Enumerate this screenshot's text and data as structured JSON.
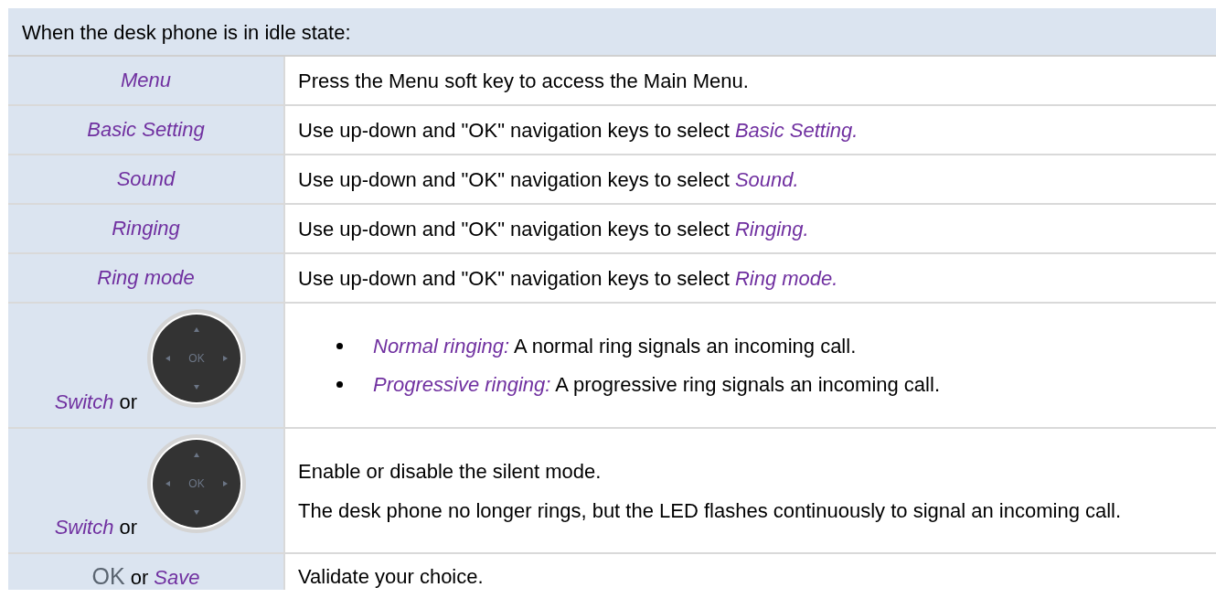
{
  "header": "When the desk phone is in idle state:",
  "rows": [
    {
      "left": [
        {
          "text": "Menu",
          "kind": "term"
        }
      ],
      "right": [
        {
          "kind": "paragraph",
          "text": "Press the Menu soft key to access the Main Menu."
        }
      ]
    },
    {
      "left": [
        {
          "text": "Basic Setting",
          "kind": "term"
        }
      ],
      "right": [
        {
          "kind": "paragraph",
          "text": "Use up-down and \"OK\" navigation keys to select *Basic Setting.*"
        }
      ]
    },
    {
      "left": [
        {
          "text": "Sound",
          "kind": "term"
        }
      ],
      "right": [
        {
          "kind": "paragraph",
          "text": "Use up-down and \"OK\" navigation keys to select *Sound.*"
        }
      ]
    },
    {
      "left": [
        {
          "text": "Ringing",
          "kind": "term"
        }
      ],
      "right": [
        {
          "kind": "paragraph",
          "text": "Use up-down and \"OK\" navigation keys to select *Ringing.*"
        }
      ]
    },
    {
      "left": [
        {
          "text": "Ring mode",
          "kind": "term"
        }
      ],
      "right": [
        {
          "kind": "paragraph",
          "text": "Use up-down and \"OK\" navigation keys to select *Ring mode.*"
        }
      ]
    },
    {
      "left": [
        {
          "text": "Switch",
          "kind": "term"
        },
        {
          "text": "or",
          "kind": "joiner"
        }
      ],
      "navpad": {
        "label": "OK"
      },
      "right": [
        {
          "kind": "bullet",
          "text": "*Normal ringing:* A normal ring signals an incoming call."
        },
        {
          "kind": "bullet",
          "text": "*Progressive ringing:* A progressive ring signals an incoming call."
        }
      ]
    },
    {
      "left": [
        {
          "text": "Switch",
          "kind": "term"
        },
        {
          "text": "or",
          "kind": "joiner"
        }
      ],
      "navpad": {
        "label": "OK"
      },
      "right": [
        {
          "kind": "paragraph",
          "text": "Enable or disable the silent mode."
        },
        {
          "kind": "paragraph",
          "text": "The desk phone no longer rings, but the LED flashes continuously to signal an incoming call."
        }
      ]
    },
    {
      "left": [
        {
          "text": "OK",
          "kind": "key"
        },
        {
          "text": "or",
          "kind": "joiner"
        },
        {
          "text": "Save",
          "kind": "term"
        }
      ],
      "right": [
        {
          "kind": "paragraph",
          "text": "Validate your choice."
        }
      ]
    }
  ]
}
